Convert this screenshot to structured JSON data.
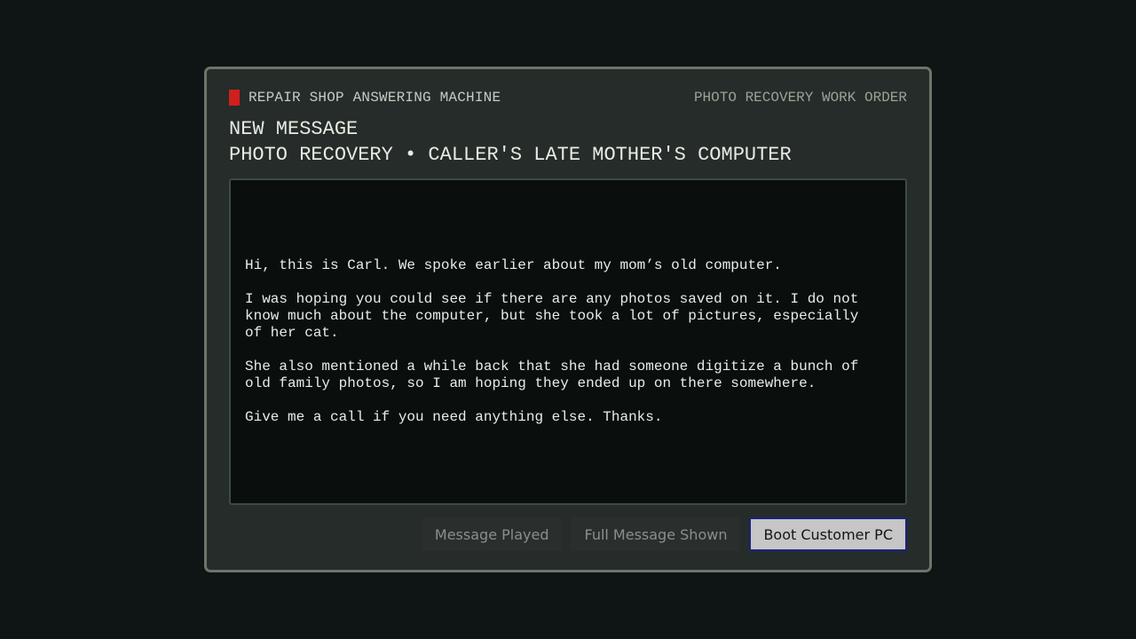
{
  "header": {
    "machine_title": "REPAIR SHOP ANSWERING MACHINE",
    "work_order": "PHOTO RECOVERY WORK ORDER",
    "indicator_color": "#d01f1f"
  },
  "headings": {
    "line1": "NEW MESSAGE",
    "line2": "PHOTO RECOVERY • CALLER'S LATE MOTHER'S COMPUTER"
  },
  "message": {
    "paragraphs": [
      "Hi, this is Carl. We spoke earlier about my mom’s old computer.",
      "I was hoping you could see if there are any photos saved on it. I do not know much about the computer, but she took a lot of pictures, especially of her cat.",
      "She also mentioned a while back that she had someone digitize a bunch of old family photos, so I am hoping they ended up on there somewhere.",
      "Give me a call if you need anything else. Thanks."
    ]
  },
  "controls": {
    "message_played": "Message Played",
    "full_message_shown": "Full Message Shown",
    "boot_pc": "Boot Customer PC"
  }
}
